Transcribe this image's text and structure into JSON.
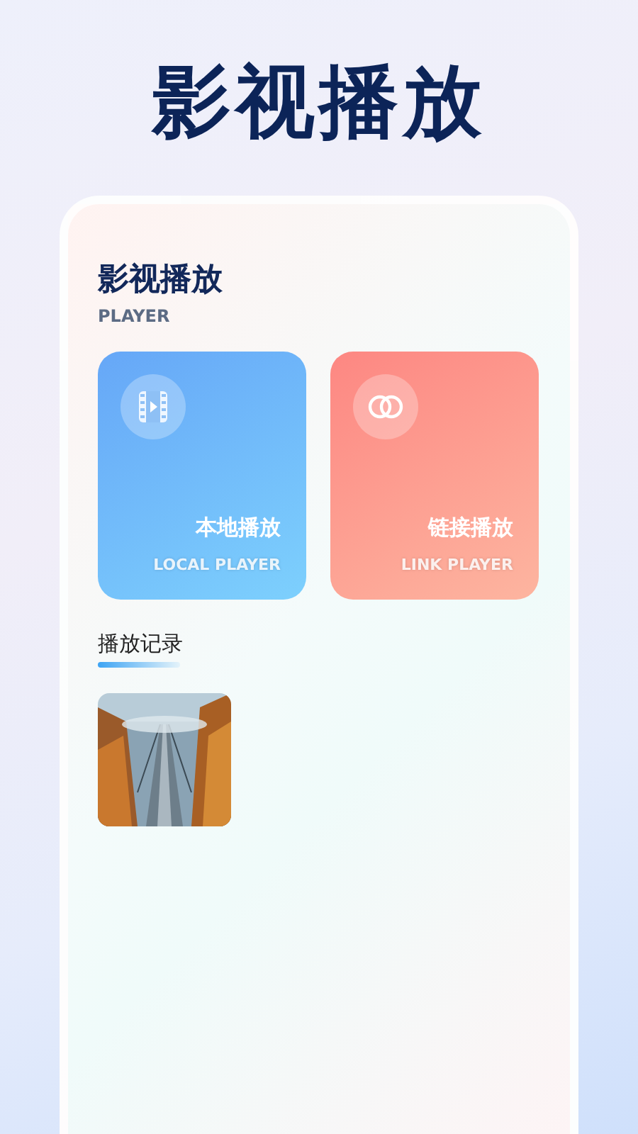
{
  "headline": "影视播放",
  "panel": {
    "title": "影视播放",
    "subtitle": "PLAYER"
  },
  "tiles": [
    {
      "kind": "local",
      "title": "本地播放",
      "subtitle": "LOCAL PLAYER"
    },
    {
      "kind": "link",
      "title": "链接播放",
      "subtitle": "LINK PLAYER"
    }
  ],
  "history": {
    "title": "播放记录"
  }
}
